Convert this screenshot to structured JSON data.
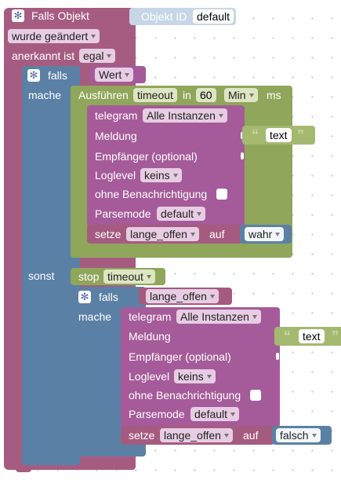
{
  "trigger": {
    "title": "Falls Objekt",
    "object_id_label": "Objekt ID",
    "object_id_value": "default",
    "condition_value": "wurde geändert",
    "ack_label": "anerkannt ist",
    "ack_value": "egal"
  },
  "if_outer": {
    "keyword": "falls",
    "condition_value": "Wert",
    "then_label": "mache",
    "else_label": "sonst"
  },
  "timeout": {
    "label": "Ausführen",
    "name": "timeout",
    "in_label": "in",
    "amount": "60",
    "unit": "Min",
    "unit_suffix": "ms"
  },
  "telegram_1": {
    "title": "telegram",
    "instance": "Alle Instanzen",
    "message_label": "Meldung",
    "message_text": "text",
    "recipient_label": "Empfänger (optional)",
    "loglevel_label": "Loglevel",
    "loglevel_value": "keins",
    "silent_label": "ohne Benachrichtigung",
    "parsemode_label": "Parsemode",
    "parsemode_value": "default"
  },
  "set_1": {
    "label": "setze",
    "variable": "lange_offen",
    "to_label": "auf",
    "value": "wahr"
  },
  "stop": {
    "label": "stop",
    "name": "timeout"
  },
  "if_inner": {
    "keyword": "falls",
    "condition_value": "lange_offen",
    "then_label": "mache"
  },
  "telegram_2": {
    "title": "telegram",
    "instance": "Alle Instanzen",
    "message_label": "Meldung",
    "message_text": "text",
    "recipient_label": "Empfänger (optional)",
    "loglevel_label": "Loglevel",
    "loglevel_value": "keins",
    "silent_label": "ohne Benachrichtigung",
    "parsemode_label": "Parsemode",
    "parsemode_value": "default"
  },
  "set_2": {
    "label": "setze",
    "variable": "lange_offen",
    "to_label": "auf",
    "value": "falsch"
  },
  "colors": {
    "event_block": "#a65c81",
    "logic_block": "#5b80a5",
    "timeout_block": "#8fa65b",
    "telegram_block": "#a55b99",
    "variable_block": "#a55b80",
    "text_block": "#a5b870",
    "object_id_block": "#c6d6e6"
  },
  "icons": {
    "gear": "gear-icon",
    "quote_open": "quote-open-icon",
    "quote_close": "quote-close-icon"
  }
}
